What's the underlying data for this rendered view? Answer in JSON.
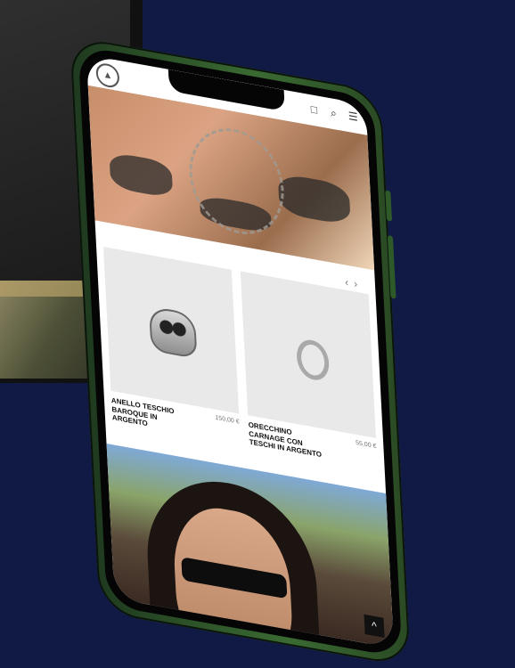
{
  "colors": {
    "background": "#101a45",
    "phone_frame": "#3a6a32"
  },
  "header": {
    "logo_icon": "triangle-logo-icon",
    "icons": [
      "bag-icon",
      "search-icon",
      "menu-icon"
    ]
  },
  "carousel": {
    "prev_icon": "‹",
    "next_icon": "›"
  },
  "products": [
    {
      "name": "ANELLO TESCHIO BAROQUE IN ARGENTO",
      "price": "150,00 €"
    },
    {
      "name": "ORECCHINO CARNAGE CON TESCHI IN ARGENTO",
      "price": "55,00 €"
    }
  ],
  "scroll_top_icon": "^"
}
